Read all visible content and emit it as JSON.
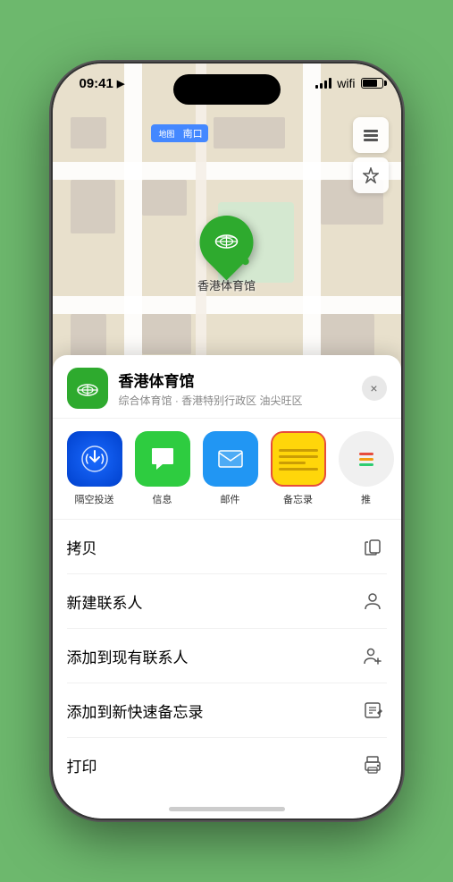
{
  "status_bar": {
    "time": "09:41",
    "location_arrow": "▶"
  },
  "map": {
    "location_label": "南口",
    "venue_name": "香港体育馆",
    "map_btn_layers": "🗺",
    "map_btn_location": "➤"
  },
  "sheet": {
    "venue_name": "香港体育馆",
    "venue_subtitle": "综合体育馆 · 香港特别行政区 油尖旺区",
    "close_label": "×"
  },
  "share_items": [
    {
      "id": "airdrop",
      "label": "隔空投送"
    },
    {
      "id": "messages",
      "label": "信息"
    },
    {
      "id": "mail",
      "label": "邮件"
    },
    {
      "id": "notes",
      "label": "备忘录",
      "selected": true
    }
  ],
  "action_items": [
    {
      "label": "拷贝",
      "icon": "copy"
    },
    {
      "label": "新建联系人",
      "icon": "person"
    },
    {
      "label": "添加到现有联系人",
      "icon": "person-add"
    },
    {
      "label": "添加到新快速备忘录",
      "icon": "note-add"
    },
    {
      "label": "打印",
      "icon": "printer"
    }
  ]
}
